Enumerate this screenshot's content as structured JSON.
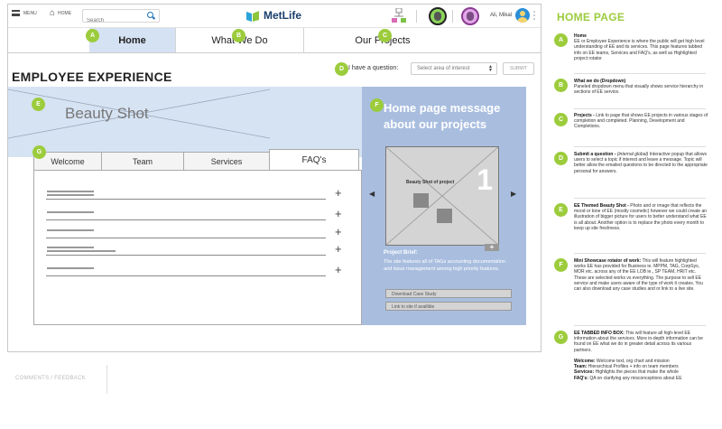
{
  "topbar": {
    "menu_label": "MENU",
    "home_label": "HOME",
    "search_placeholder": "Search",
    "brand": "MetLife",
    "user_name": "Ali, Mikal"
  },
  "nav": {
    "home": "Home",
    "what_we_do": "What We Do",
    "our_projects": "Our Projects"
  },
  "badges": {
    "a": "A",
    "b": "B",
    "c": "C",
    "d": "D",
    "e": "E",
    "f": "F",
    "g": "G"
  },
  "page": {
    "title": "EMPLOYEE EXPERIENCE",
    "question_label": "I have a question:",
    "question_select": "Select area of interest",
    "submit": "SUBMIT"
  },
  "hero": {
    "label": "Beauty Shot"
  },
  "promo": {
    "title": "Home page message about our projects",
    "image_label": "Beauty Shot of project",
    "slide_number": "1",
    "brief_title": "Project Brief:",
    "brief_text": "The site features all of TAGs accounting documentation and issue management among high priority features.",
    "download_button": "Download Case Study",
    "link_button": "Link to site if availible"
  },
  "tabs": [
    "Welcome",
    "Team",
    "Services",
    "FAQ's"
  ],
  "footer": {
    "comments": "COMMENTS / FEEDBACK"
  },
  "notes": {
    "title": "HOME PAGE",
    "items": [
      {
        "heading": "Home",
        "body": "EE or Employee Experience is where the public will get high level understanding of EE and its services. This page features tabbed info on EE teams, Services and FAQ's, as well as Highlighted project rotator"
      },
      {
        "heading": "What we do (Dropdown)",
        "body": "Paneled dropdown menu that visually shows service hierarchy in sections of EE service."
      },
      {
        "heading": "Projects -",
        "body": "Link to page that shows EE projects in various stages of completion and completed. Planning, Development and Completions."
      },
      {
        "heading": "Submit a question -",
        "note": "(internal global)",
        "body": "Interactive popup that allows users to select a topic if interest and leave a message. Topic will better allow the emailed questions to be directed to the appropriate personal for answers."
      },
      {
        "heading": "EE Themed Beauty Shot -",
        "body": "Photo and or image that reflects the mood or tone of EE (mostly cosmetic) however we could create an illustration of bigger picture for users to better understand what EE is all about. Another option is to replace the photo every month to keep up site freshness."
      },
      {
        "heading": "Mini Showcase rotator of work:",
        "body": "This will feature highlighted works EE has provided for Business ie. MPPM, TAG, CorpSys, MOR etc. across any of the EE LOB ie., SP TEAM, HRIT etc. These are selected works vs everything. The purpose to sell EE service and make users aware of the type of work it creates. You can also download any case studies and or link to a live site."
      },
      {
        "heading": "EE TABBED INFO BOX:",
        "body": "This will feature all high-level EE information about the services. More in-depth information can be found on EE what we do in greater detail across its various partners."
      }
    ],
    "tab_notes": [
      {
        "label": "Welcome:",
        "text": "Welcome text, org chart and mission"
      },
      {
        "label": "Team:",
        "text": "Hierarchical Profiles + info on team members"
      },
      {
        "label": "Services:",
        "text": "Highlights the pieces that make the whole"
      },
      {
        "label": "FAQ's:",
        "text": "QA on clarifying any misconceptions about EE"
      }
    ]
  }
}
